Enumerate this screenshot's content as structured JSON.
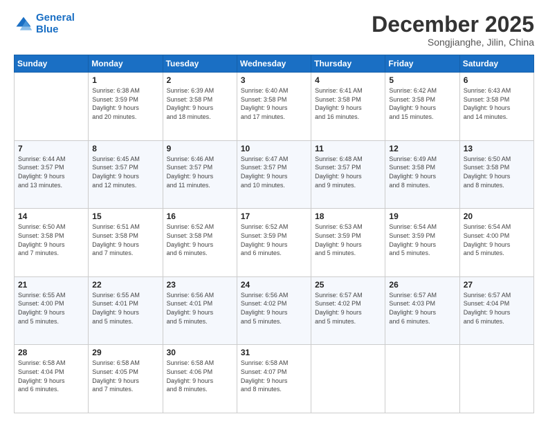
{
  "logo": {
    "line1": "General",
    "line2": "Blue"
  },
  "header": {
    "month": "December 2025",
    "location": "Songjianghe, Jilin, China"
  },
  "weekdays": [
    "Sunday",
    "Monday",
    "Tuesday",
    "Wednesday",
    "Thursday",
    "Friday",
    "Saturday"
  ],
  "weeks": [
    [
      {
        "day": "",
        "info": ""
      },
      {
        "day": "1",
        "info": "Sunrise: 6:38 AM\nSunset: 3:59 PM\nDaylight: 9 hours\nand 20 minutes."
      },
      {
        "day": "2",
        "info": "Sunrise: 6:39 AM\nSunset: 3:58 PM\nDaylight: 9 hours\nand 18 minutes."
      },
      {
        "day": "3",
        "info": "Sunrise: 6:40 AM\nSunset: 3:58 PM\nDaylight: 9 hours\nand 17 minutes."
      },
      {
        "day": "4",
        "info": "Sunrise: 6:41 AM\nSunset: 3:58 PM\nDaylight: 9 hours\nand 16 minutes."
      },
      {
        "day": "5",
        "info": "Sunrise: 6:42 AM\nSunset: 3:58 PM\nDaylight: 9 hours\nand 15 minutes."
      },
      {
        "day": "6",
        "info": "Sunrise: 6:43 AM\nSunset: 3:58 PM\nDaylight: 9 hours\nand 14 minutes."
      }
    ],
    [
      {
        "day": "7",
        "info": "Sunrise: 6:44 AM\nSunset: 3:57 PM\nDaylight: 9 hours\nand 13 minutes."
      },
      {
        "day": "8",
        "info": "Sunrise: 6:45 AM\nSunset: 3:57 PM\nDaylight: 9 hours\nand 12 minutes."
      },
      {
        "day": "9",
        "info": "Sunrise: 6:46 AM\nSunset: 3:57 PM\nDaylight: 9 hours\nand 11 minutes."
      },
      {
        "day": "10",
        "info": "Sunrise: 6:47 AM\nSunset: 3:57 PM\nDaylight: 9 hours\nand 10 minutes."
      },
      {
        "day": "11",
        "info": "Sunrise: 6:48 AM\nSunset: 3:57 PM\nDaylight: 9 hours\nand 9 minutes."
      },
      {
        "day": "12",
        "info": "Sunrise: 6:49 AM\nSunset: 3:58 PM\nDaylight: 9 hours\nand 8 minutes."
      },
      {
        "day": "13",
        "info": "Sunrise: 6:50 AM\nSunset: 3:58 PM\nDaylight: 9 hours\nand 8 minutes."
      }
    ],
    [
      {
        "day": "14",
        "info": "Sunrise: 6:50 AM\nSunset: 3:58 PM\nDaylight: 9 hours\nand 7 minutes."
      },
      {
        "day": "15",
        "info": "Sunrise: 6:51 AM\nSunset: 3:58 PM\nDaylight: 9 hours\nand 7 minutes."
      },
      {
        "day": "16",
        "info": "Sunrise: 6:52 AM\nSunset: 3:58 PM\nDaylight: 9 hours\nand 6 minutes."
      },
      {
        "day": "17",
        "info": "Sunrise: 6:52 AM\nSunset: 3:59 PM\nDaylight: 9 hours\nand 6 minutes."
      },
      {
        "day": "18",
        "info": "Sunrise: 6:53 AM\nSunset: 3:59 PM\nDaylight: 9 hours\nand 5 minutes."
      },
      {
        "day": "19",
        "info": "Sunrise: 6:54 AM\nSunset: 3:59 PM\nDaylight: 9 hours\nand 5 minutes."
      },
      {
        "day": "20",
        "info": "Sunrise: 6:54 AM\nSunset: 4:00 PM\nDaylight: 9 hours\nand 5 minutes."
      }
    ],
    [
      {
        "day": "21",
        "info": "Sunrise: 6:55 AM\nSunset: 4:00 PM\nDaylight: 9 hours\nand 5 minutes."
      },
      {
        "day": "22",
        "info": "Sunrise: 6:55 AM\nSunset: 4:01 PM\nDaylight: 9 hours\nand 5 minutes."
      },
      {
        "day": "23",
        "info": "Sunrise: 6:56 AM\nSunset: 4:01 PM\nDaylight: 9 hours\nand 5 minutes."
      },
      {
        "day": "24",
        "info": "Sunrise: 6:56 AM\nSunset: 4:02 PM\nDaylight: 9 hours\nand 5 minutes."
      },
      {
        "day": "25",
        "info": "Sunrise: 6:57 AM\nSunset: 4:02 PM\nDaylight: 9 hours\nand 5 minutes."
      },
      {
        "day": "26",
        "info": "Sunrise: 6:57 AM\nSunset: 4:03 PM\nDaylight: 9 hours\nand 6 minutes."
      },
      {
        "day": "27",
        "info": "Sunrise: 6:57 AM\nSunset: 4:04 PM\nDaylight: 9 hours\nand 6 minutes."
      }
    ],
    [
      {
        "day": "28",
        "info": "Sunrise: 6:58 AM\nSunset: 4:04 PM\nDaylight: 9 hours\nand 6 minutes."
      },
      {
        "day": "29",
        "info": "Sunrise: 6:58 AM\nSunset: 4:05 PM\nDaylight: 9 hours\nand 7 minutes."
      },
      {
        "day": "30",
        "info": "Sunrise: 6:58 AM\nSunset: 4:06 PM\nDaylight: 9 hours\nand 8 minutes."
      },
      {
        "day": "31",
        "info": "Sunrise: 6:58 AM\nSunset: 4:07 PM\nDaylight: 9 hours\nand 8 minutes."
      },
      {
        "day": "",
        "info": ""
      },
      {
        "day": "",
        "info": ""
      },
      {
        "day": "",
        "info": ""
      }
    ]
  ]
}
